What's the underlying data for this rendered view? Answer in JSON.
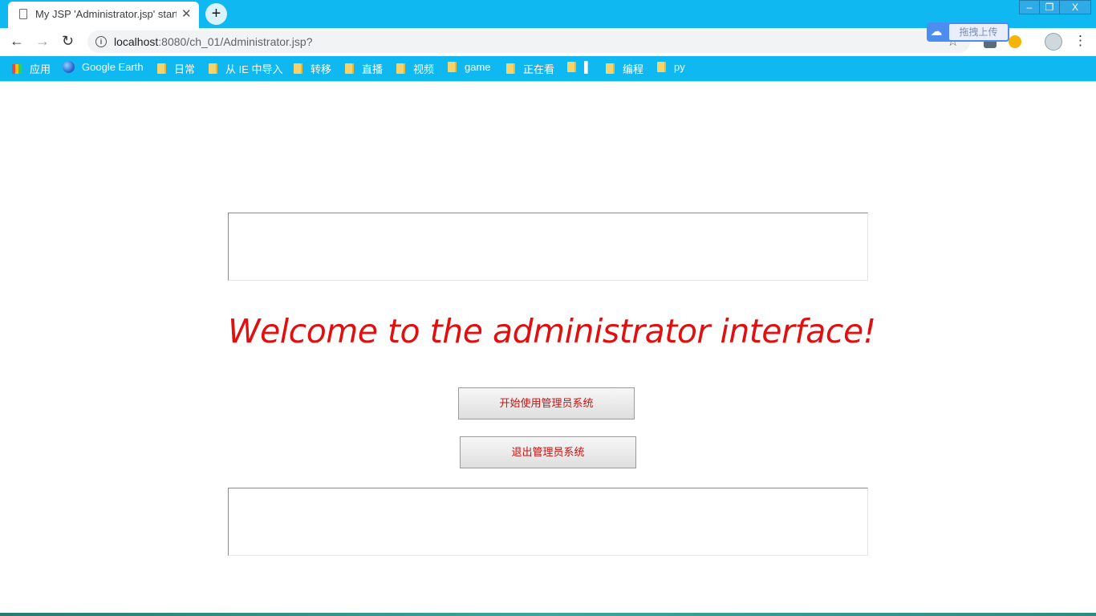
{
  "browser": {
    "tab_title": "My JSP 'Administrator.jsp' starting page",
    "tab_close": "✕",
    "new_tab": "+",
    "window_controls": {
      "minimize": "–",
      "restore": "❐",
      "close": "X"
    },
    "nav": {
      "back": "←",
      "forward": "→",
      "reload": "↻"
    },
    "url_host": "localhost",
    "url_rest": ":8080/ch_01/Administrator.jsp?",
    "info_icon": "i",
    "star": "☆",
    "upload_widget": {
      "label": "拖拽上传",
      "icon": "baidu-cloud-icon"
    },
    "menu": "⋮",
    "bookmarks": [
      {
        "label": "应用",
        "icon": "apps-icon"
      },
      {
        "label": "Google Earth",
        "icon": "google-earth-icon"
      },
      {
        "label": "日常",
        "icon": "folder-icon"
      },
      {
        "label": "从 IE 中导入",
        "icon": "folder-icon"
      },
      {
        "label": "转移",
        "icon": "folder-icon"
      },
      {
        "label": "直播",
        "icon": "folder-icon"
      },
      {
        "label": "视频",
        "icon": "folder-icon"
      },
      {
        "label": "game",
        "icon": "folder-icon"
      },
      {
        "label": "正在看",
        "icon": "folder-icon"
      },
      {
        "label": "▌",
        "icon": "folder-icon"
      },
      {
        "label": "编程",
        "icon": "folder-icon"
      },
      {
        "label": "py",
        "icon": "folder-icon"
      }
    ]
  },
  "page": {
    "welcome": "Welcome to the administrator interface!",
    "start_button": "开始使用管理员系统",
    "exit_button": "退出管理员系统"
  },
  "colors": {
    "chrome_accent": "#0fb8f0",
    "welcome_text": "#e01010",
    "button_text": "#cc1111"
  }
}
